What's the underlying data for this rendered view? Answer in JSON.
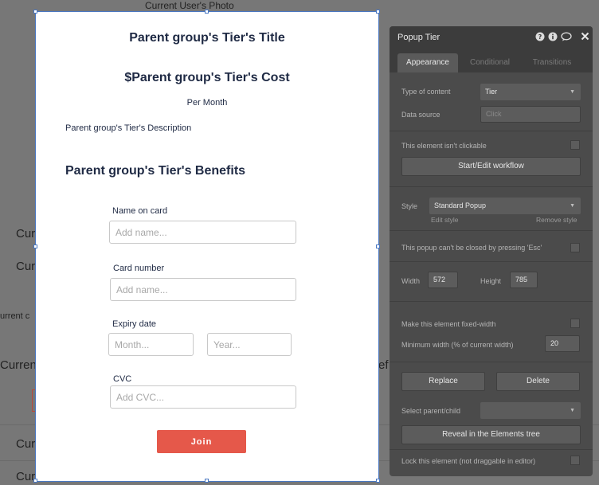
{
  "background": {
    "top_text": "Current User's Photo",
    "left_fragments": [
      "Curr",
      "Curr",
      "urrent c",
      "Curren",
      "Curr",
      "Curr"
    ],
    "right_fragment": "ef"
  },
  "popup": {
    "title": "Parent group's Tier's Title",
    "cost": "$Parent group's Tier's Cost",
    "per_month": "Per Month",
    "description": "Parent group's Tier's Description",
    "benefits_heading": "Parent group's Tier's Benefits",
    "fields": {
      "name_label": "Name on card",
      "name_placeholder": "Add name...",
      "card_label": "Card number",
      "card_placeholder": "Add name...",
      "expiry_label": "Expiry date",
      "month_placeholder": "Month...",
      "year_placeholder": "Year...",
      "cvc_label": "CVC",
      "cvc_placeholder": "Add CVC..."
    },
    "join_label": "Join",
    "accent_color": "#e5584a"
  },
  "panel": {
    "title": "Popup Tier",
    "header_icons": [
      "help-icon",
      "info-icon",
      "comment-icon",
      "close-icon"
    ],
    "tabs": [
      "Appearance",
      "Conditional",
      "Transitions"
    ],
    "type_of_content_label": "Type of content",
    "type_of_content_value": "Tier",
    "data_source_label": "Data source",
    "data_source_placeholder": "Click",
    "not_clickable_label": "This element isn't clickable",
    "workflow_button": "Start/Edit workflow",
    "style_label": "Style",
    "style_value": "Standard Popup",
    "edit_style": "Edit style",
    "remove_style": "Remove style",
    "esc_label": "This popup can't be closed by pressing 'Esc'",
    "width_label": "Width",
    "width_value": "572",
    "height_label": "Height",
    "height_value": "785",
    "fixed_width_label": "Make this element fixed-width",
    "min_width_label": "Minimum width (% of current width)",
    "min_width_value": "20",
    "replace_button": "Replace",
    "delete_button": "Delete",
    "select_parent_label": "Select parent/child",
    "reveal_button": "Reveal in the Elements tree",
    "lock_label": "Lock this element (not draggable in editor)"
  }
}
